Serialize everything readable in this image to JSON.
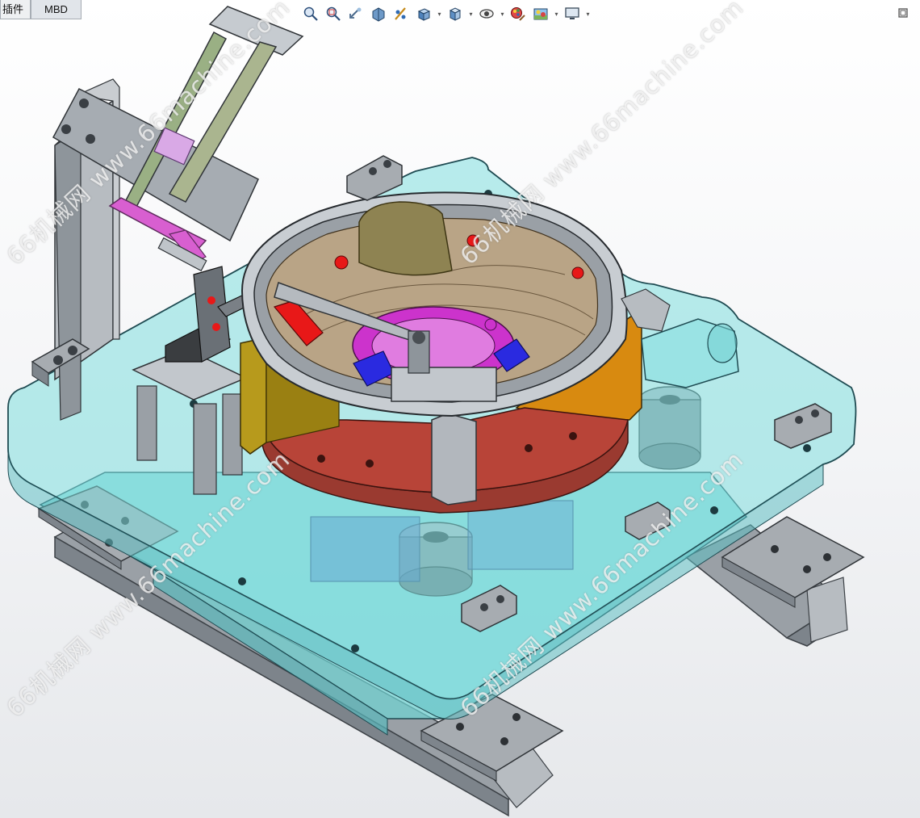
{
  "tabs": [
    {
      "label": "插件",
      "active": false
    },
    {
      "label": "MBD",
      "active": true
    }
  ],
  "toolbar": {
    "icons": [
      "zoom-to-fit-icon",
      "zoom-to-area-icon",
      "previous-view-icon",
      "section-view-icon",
      "dynamic-annotation-icon",
      "view-orientation-icon",
      "display-style-icon",
      "hide-show-items-icon",
      "edit-appearance-icon",
      "apply-scene-icon",
      "view-settings-icon"
    ]
  },
  "watermarks": [
    "66机械网 www.66machine.com",
    "66机械网 www.66machine.com",
    "66机械网 www.66machine.com",
    "66机械网 www.66machine.com"
  ],
  "colors": {
    "base_plate": "#7fdede",
    "bowl_rim": "#c8cdd2",
    "turntable": "#b84438",
    "bracket": "#b79a1c",
    "orange_bracket": "#d88a10",
    "magenta_center": "#cc33cc",
    "steel_frame": "#9aa0a6",
    "pink_part": "#e36ac8",
    "red_part": "#e81818",
    "blue_block": "#2a2ae0",
    "olive_dome": "#8e8352"
  }
}
